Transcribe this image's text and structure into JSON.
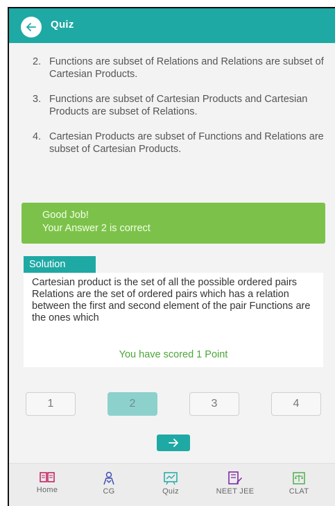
{
  "header": {
    "title": "Quiz"
  },
  "options": [
    {
      "num": "2.",
      "text": "Functions are subset of Relations and Relations are subset of Cartesian Products."
    },
    {
      "num": "3.",
      "text": "Functions are subset of Cartesian Products and Cartesian Products are subset of Relations."
    },
    {
      "num": "4.",
      "text": "Cartesian Products are subset of Functions and Relations are subset of Cartesian Products."
    }
  ],
  "feedback": {
    "line1": "Good Job!",
    "line2": "Your Answer 2 is correct"
  },
  "solution": {
    "tab_label": "Solution",
    "text": "Cartesian product is the set of all the possible ordered pairs Relations are the set of ordered pairs which has a relation between the first and second element of the pair Functions are the ones which",
    "score": "You have scored 1 Point"
  },
  "pager": {
    "pages": [
      "1",
      "2",
      "3",
      "4"
    ],
    "active": "2"
  },
  "bottom_nav": [
    {
      "label": "Home",
      "icon": "home-book-icon",
      "color": "#c2185b"
    },
    {
      "label": "CG",
      "icon": "person-icon",
      "color": "#3f51b5"
    },
    {
      "label": "Quiz",
      "icon": "quiz-board-icon",
      "color": "#1fa9a4"
    },
    {
      "label": "NEET JEE",
      "icon": "edit-document-icon",
      "color": "#7b1fa2"
    },
    {
      "label": "CLAT",
      "icon": "scales-book-icon",
      "color": "#4caf50"
    }
  ],
  "colors": {
    "primary": "#1fa9a4",
    "success": "#7cc24a",
    "score_text": "#4ca53a"
  }
}
